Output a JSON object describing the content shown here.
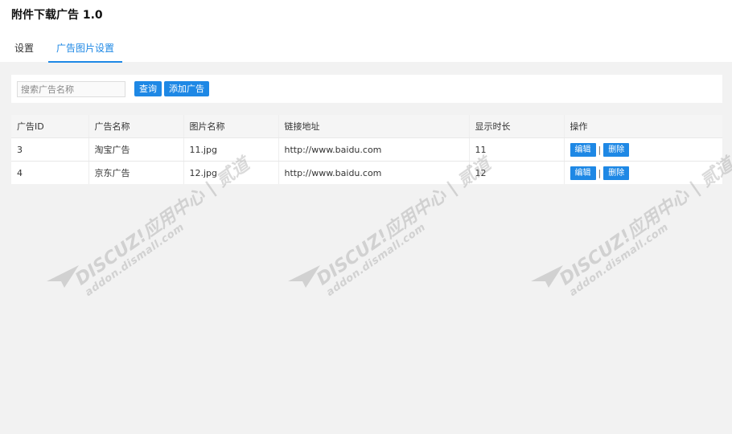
{
  "header": {
    "title": "附件下载广告 1.0"
  },
  "tabs": [
    {
      "label": "设置",
      "active": false
    },
    {
      "label": "广告图片设置",
      "active": true
    }
  ],
  "search": {
    "placeholder": "搜索广告名称",
    "value": "",
    "query_label": "查询",
    "add_label": "添加广告"
  },
  "table": {
    "columns": [
      "广告ID",
      "广告名称",
      "图片名称",
      "链接地址",
      "显示时长",
      "操作"
    ],
    "rows": [
      {
        "id": "3",
        "name": "淘宝广告",
        "image": "11.jpg",
        "url": "http://www.baidu.com",
        "duration": "11"
      },
      {
        "id": "4",
        "name": "京东广告",
        "image": "12.jpg",
        "url": "http://www.baidu.com",
        "duration": "12"
      }
    ],
    "edit_label": "编辑",
    "delete_label": "删除",
    "separator": "|"
  },
  "watermark": {
    "line1": "DISCUZ!应用中心 | 贰道",
    "line2": "addon.dismall.com"
  },
  "colors": {
    "accent": "#1e88e5",
    "background": "#f2f2f2"
  }
}
